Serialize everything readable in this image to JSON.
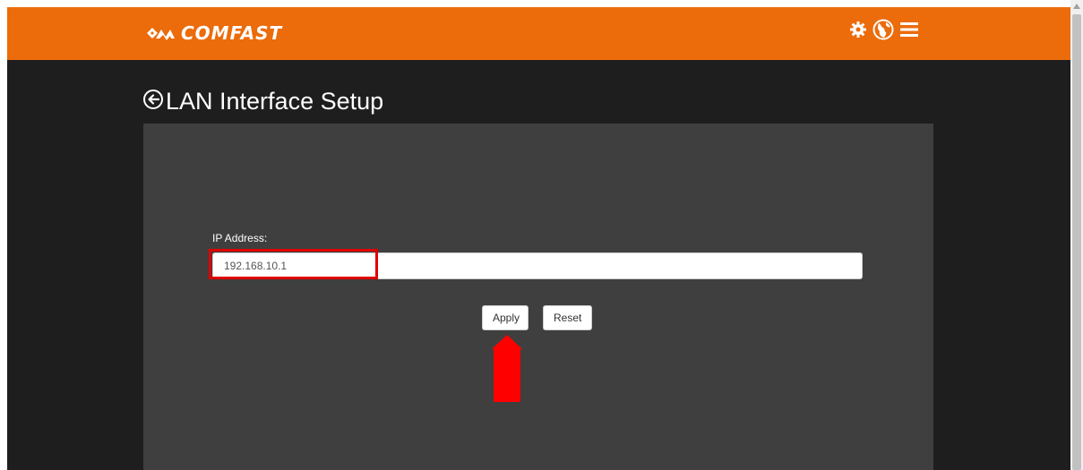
{
  "header": {
    "brand": "COMFAST",
    "icons": [
      "gear-icon",
      "globe-icon",
      "menu-icon"
    ],
    "bar_color": "#ec6b0a"
  },
  "page": {
    "title": "LAN Interface Setup",
    "back_icon": "circle-arrow-left-icon"
  },
  "form": {
    "ip_label": "IP Address:",
    "ip_value": "192.168.10.1"
  },
  "buttons": {
    "apply": "Apply",
    "reset": "Reset"
  },
  "annotation": {
    "highlight_color": "#e00000",
    "arrow_color": "#ff0000"
  },
  "colors": {
    "background": "#1e1e1e",
    "panel": "#3f3f3f"
  }
}
